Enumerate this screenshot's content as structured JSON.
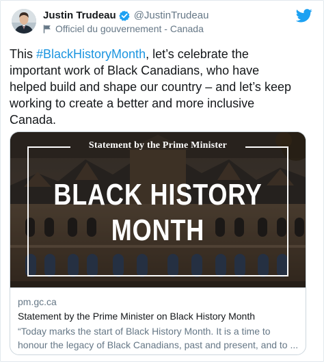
{
  "author": {
    "display_name": "Justin Trudeau",
    "handle": "@JustinTrudeau",
    "label": "Officiel du gouvernement - Canada",
    "verified": true,
    "avatar_icon": "avatar-portrait-icon"
  },
  "tweet": {
    "line1_prefix": "This ",
    "hashtag": "#BlackHistoryMonth",
    "line1_suffix": ", let’s celebrate the",
    "line2": "important work of Black Canadians, who have",
    "line3": "helped build and shape our country – and let’s keep",
    "line4": "working to create a better and more inclusive",
    "line5": "Canada."
  },
  "card": {
    "image": {
      "statement_label": "Statement by the Prime Minister",
      "headline_line1": "BLACK HISTORY",
      "headline_line2": "MONTH"
    },
    "domain": "pm.gc.ca",
    "title": "Statement by the Prime Minister on Black History Month",
    "description_line1": "“Today marks the start of Black History Month. It is a time to",
    "description_line2": "honour the legacy of Black Canadians, past and present, and to ..."
  },
  "icons": {
    "verified": "verified-badge-icon",
    "label": "flag-icon",
    "brand": "twitter-bird-icon"
  },
  "colors": {
    "brand": "#1da1f2",
    "hashtag": "#1b95e0",
    "secondary_text": "#657786",
    "primary_text": "#14171a",
    "border": "#ccd6dd"
  }
}
